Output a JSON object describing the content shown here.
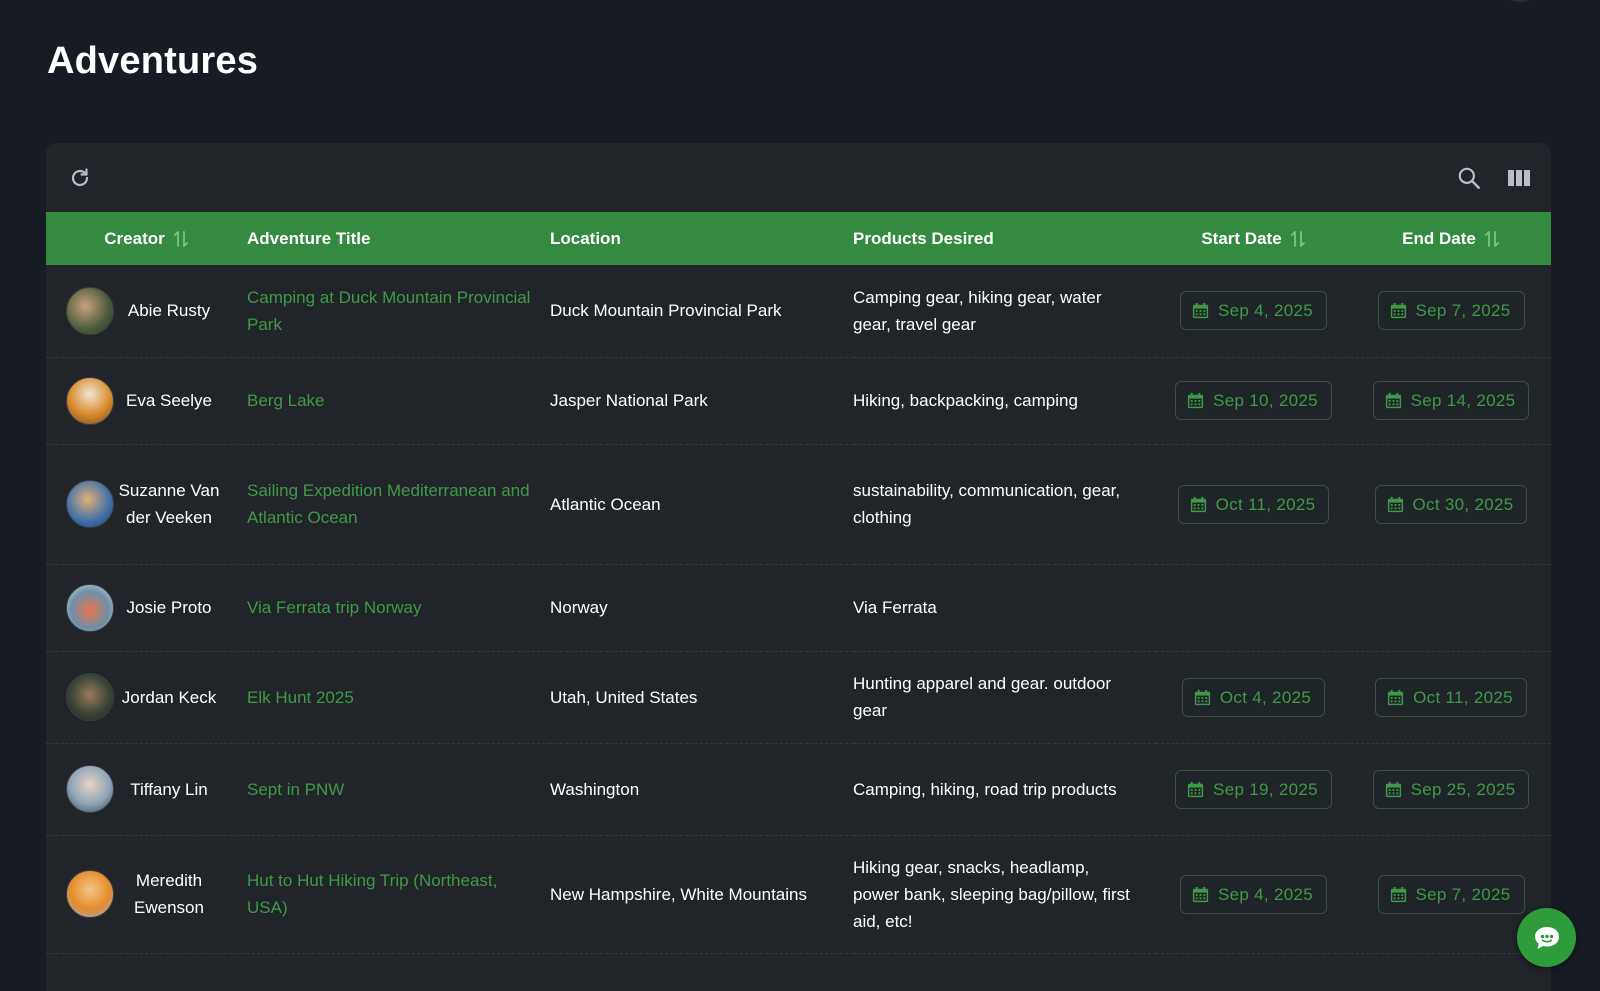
{
  "page": {
    "title": "Adventures"
  },
  "toolbar": {
    "refresh_icon": "refresh-icon",
    "search_icon": "search-icon",
    "columns_icon": "view-columns-icon"
  },
  "colors": {
    "background": "#171b24",
    "card": "#212429",
    "header_green": "#348a3f",
    "link_green": "#3f9a48",
    "fab_green": "#2f9c3c"
  },
  "table": {
    "headers": {
      "creator": "Creator",
      "title": "Adventure Title",
      "location": "Location",
      "products": "Products Desired",
      "start": "Start Date",
      "end": "End Date"
    },
    "rows": [
      {
        "creator": "Abie Rusty",
        "title": "Camping at Duck Mountain Provincial Park",
        "location": "Duck Mountain Provincial Park",
        "products": "Camping gear, hiking gear, water gear, travel gear",
        "start": "Sep 4, 2025",
        "end": "Sep 7, 2025"
      },
      {
        "creator": "Eva Seelye",
        "title": "Berg Lake",
        "location": "Jasper National Park",
        "products": "Hiking, backpacking, camping",
        "start": "Sep 10, 2025",
        "end": "Sep 14, 2025"
      },
      {
        "creator": "Suzanne Van der Veeken",
        "title": "Sailing Expedition Mediterranean and Atlantic Ocean",
        "location": "Atlantic Ocean",
        "products": "sustainability, communication, gear, clothing",
        "start": "Oct 11, 2025",
        "end": "Oct 30, 2025"
      },
      {
        "creator": "Josie Proto",
        "title": "Via Ferrata trip Norway",
        "location": "Norway",
        "products": "Via Ferrata",
        "start": "",
        "end": ""
      },
      {
        "creator": "Jordan Keck",
        "title": "Elk Hunt 2025",
        "location": "Utah, United States",
        "products": "Hunting apparel and gear. outdoor gear",
        "start": "Oct 4, 2025",
        "end": "Oct 11, 2025"
      },
      {
        "creator": "Tiffany Lin",
        "title": "Sept in PNW",
        "location": "Washington",
        "products": "Camping, hiking, road trip products",
        "start": "Sep 19, 2025",
        "end": "Sep 25, 2025"
      },
      {
        "creator": "Meredith Ewenson",
        "title": "Hut to Hut Hiking Trip (Northeast, USA)",
        "location": "New Hampshire, White Mountains",
        "products": "Hiking gear, snacks, headlamp, power bank, sleeping bag/pillow, first aid, etc!",
        "start": "Sep 4, 2025",
        "end": "Sep 7, 2025"
      }
    ]
  },
  "chat": {
    "icon": "chat-bubble-icon"
  }
}
